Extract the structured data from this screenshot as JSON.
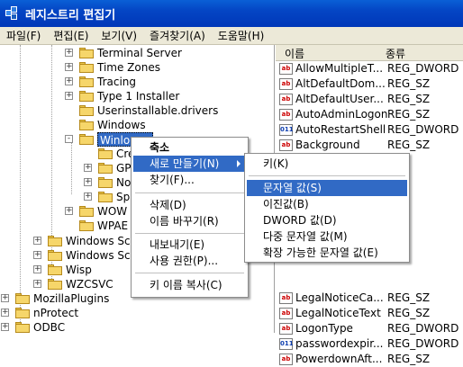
{
  "window": {
    "title": "레지스트리 편집기"
  },
  "menubar": [
    "파일(F)",
    "편집(E)",
    "보기(V)",
    "즐겨찾기(A)",
    "도움말(H)"
  ],
  "tree": {
    "items": [
      {
        "label": "Terminal Server",
        "expander": "+"
      },
      {
        "label": "Time Zones",
        "expander": "+"
      },
      {
        "label": "Tracing",
        "expander": "+"
      },
      {
        "label": "Type 1 Installer",
        "expander": "+"
      },
      {
        "label": "Userinstallable.drivers",
        "expander": ""
      },
      {
        "label": "Windows",
        "expander": ""
      },
      {
        "label": "Winlogon",
        "expander": "-"
      },
      {
        "label": "Cre",
        "expander": ""
      },
      {
        "label": "GP",
        "expander": "+"
      },
      {
        "label": "No",
        "expander": "+"
      },
      {
        "label": "Sp",
        "expander": "+"
      },
      {
        "label": "WOW",
        "expander": "+"
      },
      {
        "label": "WPAE",
        "expander": ""
      },
      {
        "label": "Windows Scr",
        "expander": "+"
      },
      {
        "label": "Windows Scr",
        "expander": "+"
      },
      {
        "label": "Wisp",
        "expander": "+"
      },
      {
        "label": "WZCSVC",
        "expander": "+"
      },
      {
        "label": "MozillaPlugins",
        "expander": "+"
      },
      {
        "label": "nProtect",
        "expander": "+"
      },
      {
        "label": "ODBC",
        "expander": "+"
      }
    ]
  },
  "values": {
    "header_name": "이름",
    "header_type": "종류",
    "rows": [
      {
        "icon": "ab-string-icon",
        "name": "AllowMultipleT...",
        "type": "REG_DWORD"
      },
      {
        "icon": "ab-string-icon",
        "name": "AltDefaultDom...",
        "type": "REG_SZ"
      },
      {
        "icon": "ab-string-icon",
        "name": "AltDefaultUser...",
        "type": "REG_SZ"
      },
      {
        "icon": "ab-string-icon",
        "name": "AutoAdminLogon",
        "type": "REG_SZ"
      },
      {
        "icon": "dword-icon",
        "name": "AutoRestartShell",
        "type": "REG_DWORD"
      },
      {
        "icon": "ab-string-icon",
        "name": "Background",
        "type": "REG_SZ"
      },
      {
        "icon": "ab-string-icon",
        "name": "LegalNoticeCa...",
        "type": "REG_SZ"
      },
      {
        "icon": "ab-string-icon",
        "name": "LegalNoticeText",
        "type": "REG_SZ"
      },
      {
        "icon": "ab-string-icon",
        "name": "LogonType",
        "type": "REG_DWORD"
      },
      {
        "icon": "dword-icon",
        "name": "passwordexpir...",
        "type": "REG_DWORD"
      },
      {
        "icon": "ab-string-icon",
        "name": "PowerdownAft...",
        "type": "REG_SZ"
      }
    ]
  },
  "context_menu": {
    "items": [
      "축소",
      "새로 만들기(N)",
      "찾기(F)...",
      "삭제(D)",
      "이름 바꾸기(R)",
      "내보내기(E)",
      "사용 권한(P)...",
      "키 이름 복사(C)"
    ]
  },
  "submenu": {
    "items": [
      "키(K)",
      "문자열 값(S)",
      "이진값(B)",
      "DWORD 값(D)",
      "다중 문자열 값(M)",
      "확장 가능한 문자열 값(E)"
    ]
  },
  "colors": {
    "title_bar": "#0445c4",
    "highlight": "#316ac5",
    "menu_bg": "#ece9d8"
  }
}
